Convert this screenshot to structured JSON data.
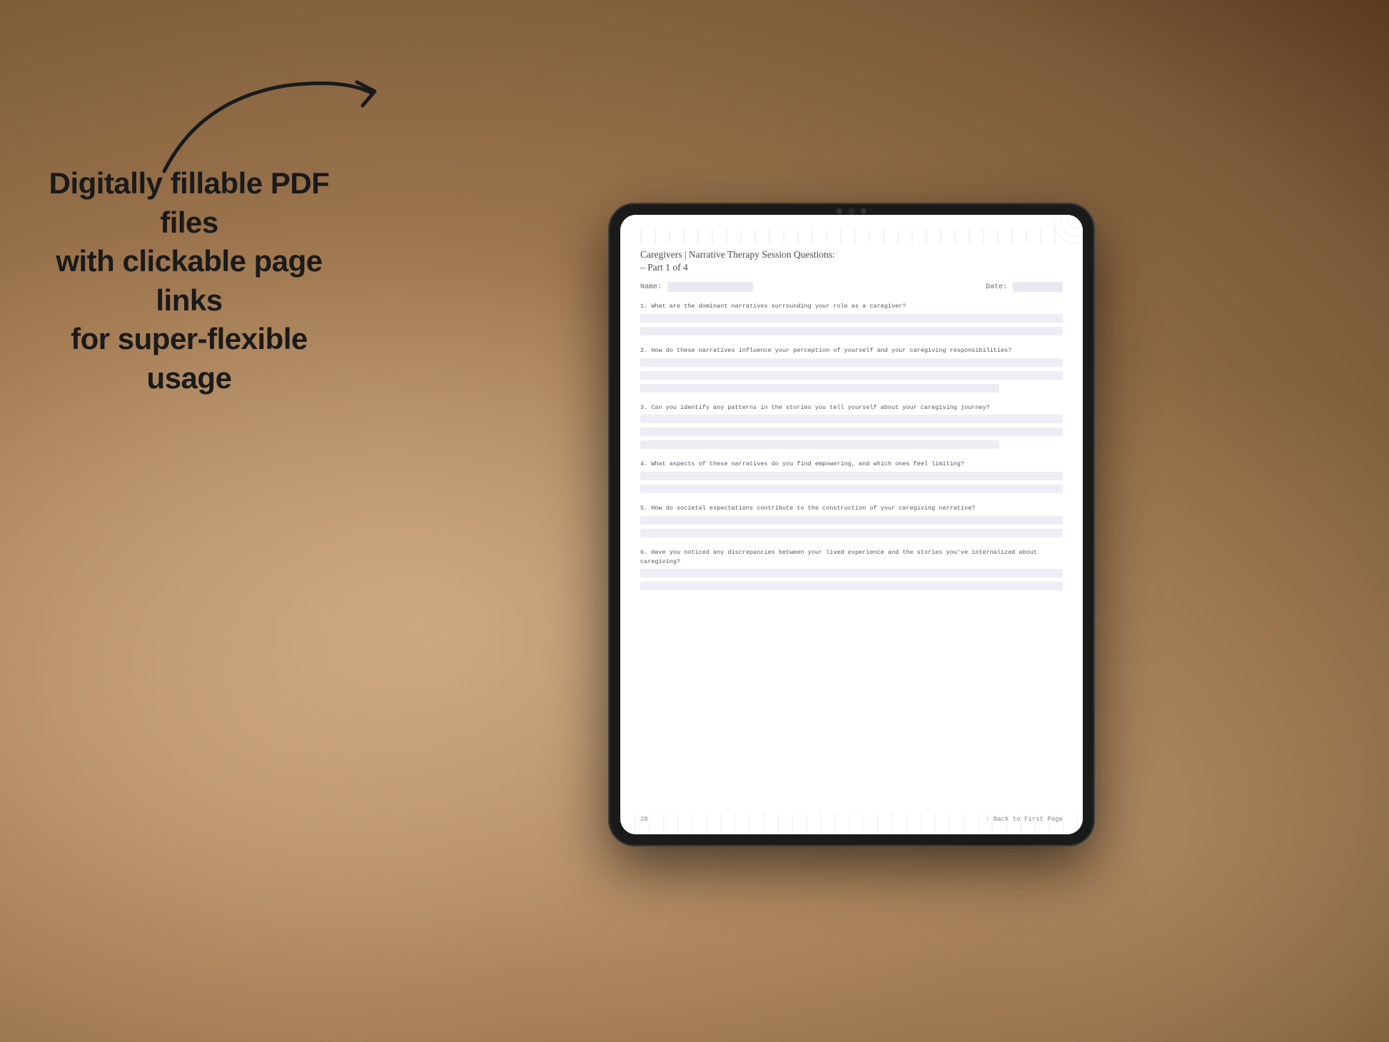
{
  "background": {
    "color": "#b8967a"
  },
  "left_panel": {
    "arrow_present": true,
    "headline_line1": "Digitally fillable PDF files",
    "headline_line2": "with clickable page links",
    "headline_line3": "for super-flexible usage"
  },
  "tablet": {
    "pdf": {
      "title": "Caregivers | Narrative Therapy Session Questions:",
      "subtitle": "– Part 1 of 4",
      "name_label": "Name:",
      "date_label": "Date:",
      "questions": [
        {
          "number": "1.",
          "text": "What are the dominant narratives surrounding your role as a caregiver?"
        },
        {
          "number": "2.",
          "text": "How do these narratives influence your perception of yourself and your caregiving responsibilities?"
        },
        {
          "number": "3.",
          "text": "Can you identify any patterns in the stories you tell yourself about your caregiving journey?"
        },
        {
          "number": "4.",
          "text": "What aspects of these narratives do you find empowering, and which ones feel limiting?"
        },
        {
          "number": "5.",
          "text": "How do societal expectations contribute to the construction of your caregiving narrative?"
        },
        {
          "number": "6.",
          "text": "Have you noticed any discrepancies between your lived experience and the stories you've internalized about caregiving?"
        }
      ],
      "footer": {
        "page_number": "20",
        "back_link": "↑ Back to First Page"
      }
    }
  }
}
